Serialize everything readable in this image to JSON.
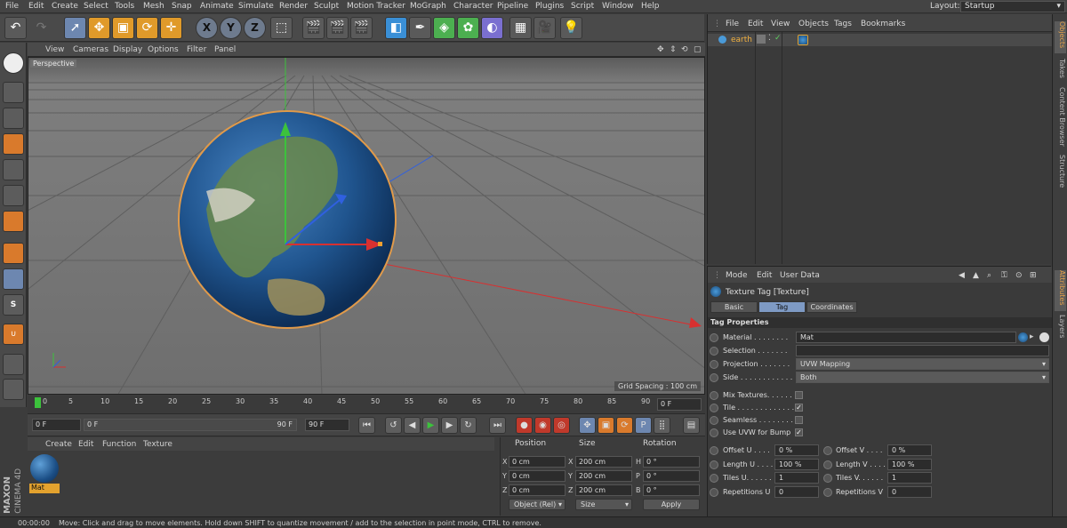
{
  "menubar": {
    "items": [
      "File",
      "Edit",
      "Create",
      "Select",
      "Tools",
      "Mesh",
      "Snap",
      "Animate",
      "Simulate",
      "Render",
      "Sculpt",
      "Motion Tracker",
      "MoGraph",
      "Character",
      "Pipeline",
      "Plugins",
      "Script",
      "Window",
      "Help"
    ],
    "layout_label": "Layout:",
    "layout_value": "Startup"
  },
  "viewport": {
    "menu": [
      "View",
      "Cameras",
      "Display",
      "Options",
      "Filter",
      "Panel"
    ],
    "label": "Perspective",
    "grid_spacing": "Grid Spacing : 100 cm"
  },
  "timeline": {
    "ticks": [
      "0",
      "5",
      "10",
      "15",
      "20",
      "25",
      "30",
      "35",
      "40",
      "45",
      "50",
      "55",
      "60",
      "65",
      "70",
      "75",
      "80",
      "85",
      "90"
    ],
    "current_frame": "0 F",
    "start_frame": "0 F",
    "range_start": "0 F",
    "range_end": "90 F",
    "end_frame": "90 F"
  },
  "material_manager": {
    "menu": [
      "Create",
      "Edit",
      "Function",
      "Texture"
    ],
    "material_name": "Mat"
  },
  "brand": {
    "maxon": "MAXON",
    "product": "CINEMA 4D"
  },
  "coordinates": {
    "headers": [
      "Position",
      "Size",
      "Rotation"
    ],
    "rows": [
      {
        "axis": "X",
        "pos": "0 cm",
        "size": "200 cm",
        "rot_axis": "H",
        "rot": "0 °"
      },
      {
        "axis": "Y",
        "pos": "0 cm",
        "size": "200 cm",
        "rot_axis": "P",
        "rot": "0 °"
      },
      {
        "axis": "Z",
        "pos": "0 cm",
        "size": "200 cm",
        "rot_axis": "B",
        "rot": "0 °"
      }
    ],
    "mode": "Object (Rel)",
    "size_mode": "Size",
    "apply": "Apply"
  },
  "status": {
    "time": "00:00:00",
    "message": "Move: Click and drag to move elements. Hold down SHIFT to quantize movement / add to the selection in point mode, CTRL to remove."
  },
  "object_manager": {
    "menu": [
      "File",
      "Edit",
      "View",
      "Objects",
      "Tags",
      "Bookmarks"
    ],
    "object_name": "earth"
  },
  "side_tabs_top": [
    "Objects",
    "Takes",
    "Content Browser",
    "Structure"
  ],
  "side_tabs_bottom": [
    "Attributes",
    "Layers"
  ],
  "attributes": {
    "menu": [
      "Mode",
      "Edit",
      "User Data"
    ],
    "title": "Texture Tag [Texture]",
    "tabs": [
      "Basic",
      "Tag",
      "Coordinates"
    ],
    "section": "Tag Properties",
    "material_label": "Material . . . . . . . .",
    "material_value": "Mat",
    "selection_label": "Selection . . . . . . .",
    "projection_label": "Projection . . . . . . .",
    "projection_value": "UVW Mapping",
    "side_label": "Side . . . . . . . . . . . .",
    "side_value": "Both",
    "mix_label": "Mix Textures. . . . . .",
    "tile_label": "Tile . . . . . . . . . . . . .",
    "seamless_label": "Seamless . . . . . . . .",
    "uvw_bump_label": "Use UVW for Bump",
    "offset_u_label": "Offset U . . . .",
    "offset_u": "0 %",
    "offset_v_label": "Offset V . . . .",
    "offset_v": "0 %",
    "length_u_label": "Length U . . . .",
    "length_u": "100 %",
    "length_v_label": "Length V . . . .",
    "length_v": "100 %",
    "tiles_u_label": "Tiles U. . . . . .",
    "tiles_u": "1",
    "tiles_v_label": "Tiles V. . . . . .",
    "tiles_v": "1",
    "rep_u_label": "Repetitions U",
    "rep_u": "0",
    "rep_v_label": "Repetitions V",
    "rep_v": "0"
  }
}
